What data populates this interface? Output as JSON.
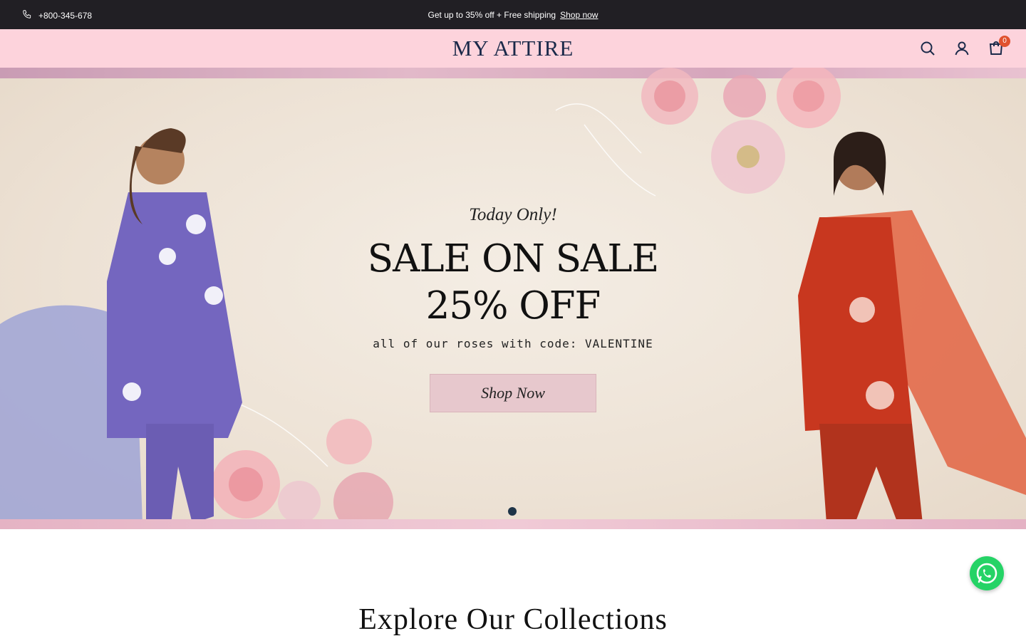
{
  "announcement": {
    "phone": "+800-345-678",
    "promo_text": "Get up to 35% off + Free shipping",
    "promo_link": "Shop now"
  },
  "header": {
    "logo": "MY ATTIRE",
    "cart_count": "0",
    "icons": [
      "search-icon",
      "account-icon",
      "cart-icon"
    ]
  },
  "hero": {
    "kicker": "Today Only!",
    "headline_line1": "SALE ON SALE",
    "headline_line2": "25% OFF",
    "subtext": "all of our roses with code: VALENTINE",
    "cta": "Shop Now",
    "slide_count": 1,
    "active_slide": 1
  },
  "collections": {
    "title": "Explore Our Collections"
  },
  "colors": {
    "topbar": "#211f24",
    "header": "#fdd3dc",
    "cta": "#e7c8cd",
    "cart_badge": "#e0522f",
    "whatsapp": "#25d366"
  }
}
